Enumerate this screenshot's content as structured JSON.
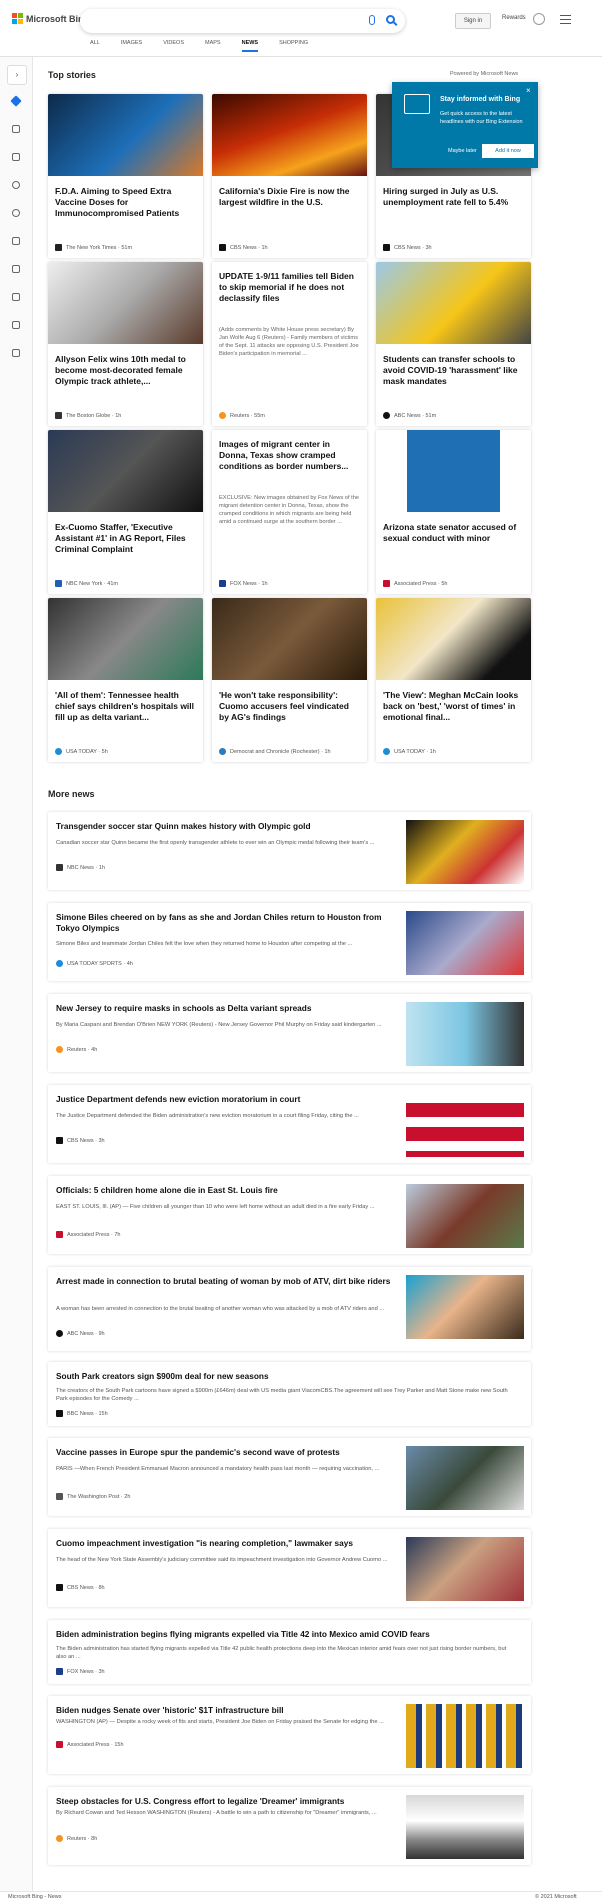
{
  "header": {
    "logo_text": "Microsoft Bing",
    "signin": "Sign in",
    "rewards": "Rewards",
    "tabs": [
      "ALL",
      "IMAGES",
      "VIDEOS",
      "MAPS",
      "NEWS",
      "SHOPPING"
    ]
  },
  "top_stories": {
    "title": "Top stories",
    "powered": "Powered by Microsoft News",
    "cards": [
      {
        "title": "F.D.A. Aiming to Speed Extra Vaccine Doses for Immunocompromised Patients",
        "source": "The New York Times · 51m"
      },
      {
        "title": "California's Dixie Fire is now the largest wildfire in the U.S.",
        "source": "CBS News · 1h"
      },
      {
        "title": "Hiring surged in July as U.S. unemployment rate fell to 5.4%",
        "source": "CBS News · 3h"
      },
      {
        "title": "Allyson Felix wins 10th medal to become most-decorated female Olympic track athlete,...",
        "source": "The Boston Globe · 1h"
      },
      {
        "title": "UPDATE 1-9/11 families tell Biden to skip memorial if he does not declassify files",
        "snippet": "(Adds comments by White House press secretary) By Jan Wolfe Aug 6 (Reuters) - Family members of victims of the Sept. 11 attacks are opposing U.S. President Joe Biden's participation in memorial ...",
        "source": "Reuters · 55m"
      },
      {
        "title": "Students can transfer schools to avoid COVID-19 'harassment' like mask mandates",
        "source": "ABC News · 51m"
      },
      {
        "title": "Ex-Cuomo Staffer, 'Executive Assistant #1' in AG Report, Files Criminal Complaint",
        "source": "NBC New York · 41m"
      },
      {
        "title": "Images of migrant center in Donna, Texas show cramped conditions as border numbers...",
        "snippet": "EXCLUSIVE: New images obtained by Fox News of the migrant detention center in Donna, Texas, show the cramped conditions in which migrants are being held amid a continued surge at the southern border ...",
        "source": "FOX News · 1h"
      },
      {
        "title": "Arizona state senator accused of sexual conduct with minor",
        "source": "Associated Press · 5h"
      },
      {
        "title": "'All of them': Tennessee health chief says children's hospitals will fill up as delta variant...",
        "source": "USA TODAY · 5h"
      },
      {
        "title": "'He won't take responsibility': Cuomo accusers feel vindicated by AG's findings",
        "source": "Democrat and Chronicle (Rochester) · 1h"
      },
      {
        "title": "'The View': Meghan McCain looks back on 'best,' 'worst of times' in emotional final...",
        "source": "USA TODAY · 1h"
      }
    ]
  },
  "popup": {
    "title": "Stay informed with Bing",
    "text": "Get quick access to the latest headlines with our Bing Extension",
    "later": "Maybe later",
    "add": "Add it now",
    "close": "×"
  },
  "more_news": {
    "title": "More news",
    "items": [
      {
        "title": "Transgender soccer star Quinn makes history with Olympic gold",
        "snippet": "Canadian soccer star Quinn became the first openly transgender athlete to ever win an Olympic medal following their team's ...",
        "source": "NBC News · 1h"
      },
      {
        "title": "Simone Biles cheered on by fans as she and Jordan Chiles return to Houston from Tokyo Olympics",
        "snippet": "Simone Biles and teammate Jordan Chiles felt the love when they returned home to Houston after competing at the ...",
        "source": "USA TODAY SPORTS · 4h"
      },
      {
        "title": "New Jersey to require masks in schools as Delta variant spreads",
        "snippet": "By Maria Caspani and Brendan O'Brien NEW YORK (Reuters) - New Jersey Governor Phil Murphy on Friday said kindergarten ...",
        "source": "Reuters · 4h"
      },
      {
        "title": "Justice Department defends new eviction moratorium in court",
        "snippet": "The Justice Department defended the Biden administration's new eviction moratorium in a court filing Friday, citing the ...",
        "source": "CBS News · 3h"
      },
      {
        "title": "Officials: 5 children home alone die in East St. Louis fire",
        "snippet": "EAST ST. LOUIS, Ill. (AP) — Five children all younger than 10 who were left home without an adult died in a fire early Friday ...",
        "source": "Associated Press · 7h"
      },
      {
        "title": "Arrest made in connection to brutal beating of woman by mob of ATV, dirt bike riders",
        "snippet": "A woman has been arrested in connection to the brutal beating of another woman who was attacked by a mob of ATV riders and ...",
        "source": "ABC News · 9h"
      },
      {
        "title": "South Park creators sign $900m deal for new seasons",
        "snippet": "The creators of the South Park cartoons have signed a $900m (£646m) deal with US media giant ViacomCBS.The agreement will see Trey Parker and Matt Stone make new South Park episodes for the Comedy ...",
        "source": "BBC News · 15h"
      },
      {
        "title": "Vaccine passes in Europe spur the pandemic's second wave of protests",
        "snippet": "PARIS —When French President Emmanuel Macron announced a mandatory health pass last month — requiring vaccination, ...",
        "source": "The Washington Post · 2h"
      },
      {
        "title": "Cuomo impeachment investigation \"is nearing completion,\" lawmaker says",
        "snippet": "The head of the New York State Assembly's judiciary committee said its impeachment investigation into Governor Andrew Cuomo ...",
        "source": "CBS News · 8h"
      },
      {
        "title": "Biden administration begins flying migrants expelled via Title 42 into Mexico amid COVID fears",
        "snippet": "The Biden administration has started flying migrants expelled via Title 42 public health protections deep into the Mexican interior amid fears over not just rising border numbers, but also an ...",
        "source": "FOX News · 3h"
      },
      {
        "title": "Biden nudges Senate over 'historic' $1T infrastructure bill",
        "snippet": "WASHINGTON (AP) — Despite a rocky week of fits and starts, President Joe Biden on Friday praised the Senate for edging the ...",
        "source": "Associated Press · 15h"
      },
      {
        "title": "Steep obstacles for U.S. Congress effort to legalize 'Dreamer' immigrants",
        "snippet": "By Richard Cowan and Ted Hesson WASHINGTON (Reuters) - A battle to win a path to citizenship for \"Dreamer\" immigrants, ...",
        "source": "Reuters · 8h"
      }
    ]
  },
  "footer": {
    "left": "Microsoft Bing - News",
    "right": "© 2021 Microsoft"
  },
  "colors": {
    "accent": "#1a73e8",
    "popup": "#0078a8"
  }
}
